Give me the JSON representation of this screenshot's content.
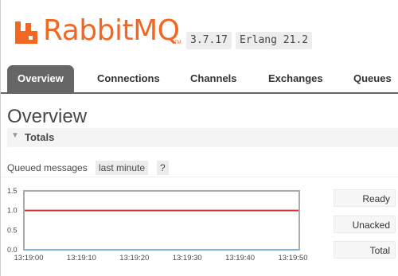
{
  "header": {
    "logo_text": "RabbitMQ",
    "trademark": "TM",
    "version": "3.7.17",
    "erlang": "Erlang 21.2",
    "brand_color": "#f26722"
  },
  "nav": {
    "tabs": [
      {
        "label": "Overview",
        "active": true
      },
      {
        "label": "Connections",
        "active": false
      },
      {
        "label": "Channels",
        "active": false
      },
      {
        "label": "Exchanges",
        "active": false
      },
      {
        "label": "Queues",
        "active": false
      }
    ]
  },
  "page": {
    "title": "Overview",
    "section": "Totals",
    "queued_label": "Queued messages",
    "range": "last minute",
    "help": "?"
  },
  "chart_data": {
    "type": "line",
    "x": [
      "13:19:00",
      "13:19:10",
      "13:19:20",
      "13:19:30",
      "13:19:40",
      "13:19:50"
    ],
    "ylim": [
      0.0,
      1.5
    ],
    "yticks": [
      "0.0",
      "0.5",
      "1.0",
      "1.5"
    ],
    "series": [
      {
        "name": "Ready",
        "color": "#c9302c",
        "values": [
          1.0,
          1.0,
          1.0,
          1.0,
          1.0,
          1.0
        ]
      },
      {
        "name": "Unacked",
        "color": "#7cb5d6",
        "values": [
          0.0,
          0.0,
          0.0,
          0.0,
          0.0,
          0.0
        ]
      }
    ]
  },
  "legend": {
    "ready": "Ready",
    "unacked": "Unacked",
    "total": "Total"
  }
}
